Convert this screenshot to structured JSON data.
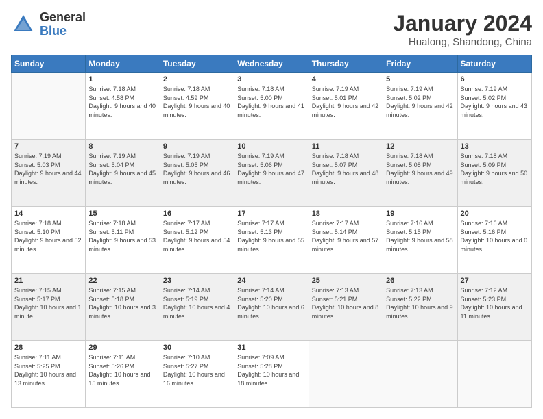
{
  "logo": {
    "general": "General",
    "blue": "Blue"
  },
  "title": "January 2024",
  "location": "Hualong, Shandong, China",
  "days": [
    "Sunday",
    "Monday",
    "Tuesday",
    "Wednesday",
    "Thursday",
    "Friday",
    "Saturday"
  ],
  "weeks": [
    [
      {
        "day": "",
        "empty": true
      },
      {
        "day": "1",
        "sunrise": "7:18 AM",
        "sunset": "4:58 PM",
        "daylight": "9 hours and 40 minutes."
      },
      {
        "day": "2",
        "sunrise": "7:18 AM",
        "sunset": "4:59 PM",
        "daylight": "9 hours and 40 minutes."
      },
      {
        "day": "3",
        "sunrise": "7:18 AM",
        "sunset": "5:00 PM",
        "daylight": "9 hours and 41 minutes."
      },
      {
        "day": "4",
        "sunrise": "7:19 AM",
        "sunset": "5:01 PM",
        "daylight": "9 hours and 42 minutes."
      },
      {
        "day": "5",
        "sunrise": "7:19 AM",
        "sunset": "5:02 PM",
        "daylight": "9 hours and 42 minutes."
      },
      {
        "day": "6",
        "sunrise": "7:19 AM",
        "sunset": "5:02 PM",
        "daylight": "9 hours and 43 minutes."
      }
    ],
    [
      {
        "day": "7",
        "sunrise": "7:19 AM",
        "sunset": "5:03 PM",
        "daylight": "9 hours and 44 minutes."
      },
      {
        "day": "8",
        "sunrise": "7:19 AM",
        "sunset": "5:04 PM",
        "daylight": "9 hours and 45 minutes."
      },
      {
        "day": "9",
        "sunrise": "7:19 AM",
        "sunset": "5:05 PM",
        "daylight": "9 hours and 46 minutes."
      },
      {
        "day": "10",
        "sunrise": "7:19 AM",
        "sunset": "5:06 PM",
        "daylight": "9 hours and 47 minutes."
      },
      {
        "day": "11",
        "sunrise": "7:18 AM",
        "sunset": "5:07 PM",
        "daylight": "9 hours and 48 minutes."
      },
      {
        "day": "12",
        "sunrise": "7:18 AM",
        "sunset": "5:08 PM",
        "daylight": "9 hours and 49 minutes."
      },
      {
        "day": "13",
        "sunrise": "7:18 AM",
        "sunset": "5:09 PM",
        "daylight": "9 hours and 50 minutes."
      }
    ],
    [
      {
        "day": "14",
        "sunrise": "7:18 AM",
        "sunset": "5:10 PM",
        "daylight": "9 hours and 52 minutes."
      },
      {
        "day": "15",
        "sunrise": "7:18 AM",
        "sunset": "5:11 PM",
        "daylight": "9 hours and 53 minutes."
      },
      {
        "day": "16",
        "sunrise": "7:17 AM",
        "sunset": "5:12 PM",
        "daylight": "9 hours and 54 minutes."
      },
      {
        "day": "17",
        "sunrise": "7:17 AM",
        "sunset": "5:13 PM",
        "daylight": "9 hours and 55 minutes."
      },
      {
        "day": "18",
        "sunrise": "7:17 AM",
        "sunset": "5:14 PM",
        "daylight": "9 hours and 57 minutes."
      },
      {
        "day": "19",
        "sunrise": "7:16 AM",
        "sunset": "5:15 PM",
        "daylight": "9 hours and 58 minutes."
      },
      {
        "day": "20",
        "sunrise": "7:16 AM",
        "sunset": "5:16 PM",
        "daylight": "10 hours and 0 minutes."
      }
    ],
    [
      {
        "day": "21",
        "sunrise": "7:15 AM",
        "sunset": "5:17 PM",
        "daylight": "10 hours and 1 minute."
      },
      {
        "day": "22",
        "sunrise": "7:15 AM",
        "sunset": "5:18 PM",
        "daylight": "10 hours and 3 minutes."
      },
      {
        "day": "23",
        "sunrise": "7:14 AM",
        "sunset": "5:19 PM",
        "daylight": "10 hours and 4 minutes."
      },
      {
        "day": "24",
        "sunrise": "7:14 AM",
        "sunset": "5:20 PM",
        "daylight": "10 hours and 6 minutes."
      },
      {
        "day": "25",
        "sunrise": "7:13 AM",
        "sunset": "5:21 PM",
        "daylight": "10 hours and 8 minutes."
      },
      {
        "day": "26",
        "sunrise": "7:13 AM",
        "sunset": "5:22 PM",
        "daylight": "10 hours and 9 minutes."
      },
      {
        "day": "27",
        "sunrise": "7:12 AM",
        "sunset": "5:23 PM",
        "daylight": "10 hours and 11 minutes."
      }
    ],
    [
      {
        "day": "28",
        "sunrise": "7:11 AM",
        "sunset": "5:25 PM",
        "daylight": "10 hours and 13 minutes."
      },
      {
        "day": "29",
        "sunrise": "7:11 AM",
        "sunset": "5:26 PM",
        "daylight": "10 hours and 15 minutes."
      },
      {
        "day": "30",
        "sunrise": "7:10 AM",
        "sunset": "5:27 PM",
        "daylight": "10 hours and 16 minutes."
      },
      {
        "day": "31",
        "sunrise": "7:09 AM",
        "sunset": "5:28 PM",
        "daylight": "10 hours and 18 minutes."
      },
      {
        "day": "",
        "empty": true
      },
      {
        "day": "",
        "empty": true
      },
      {
        "day": "",
        "empty": true
      }
    ]
  ]
}
